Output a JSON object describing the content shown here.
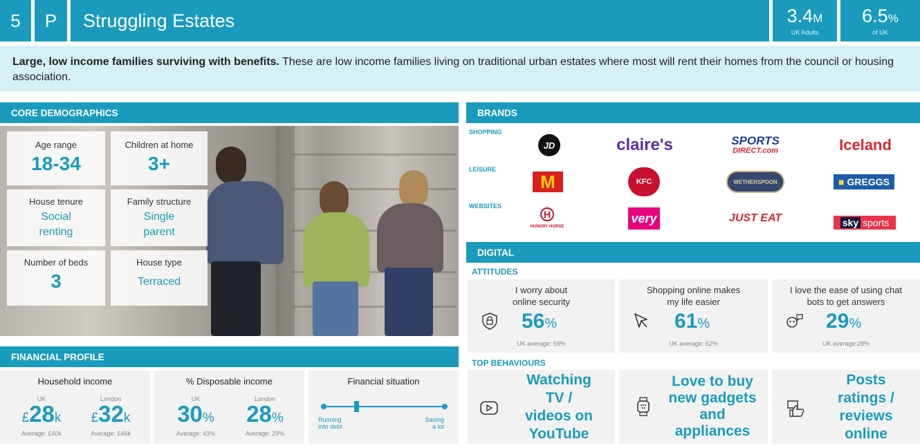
{
  "header": {
    "number": "5",
    "letter": "P",
    "title": "Struggling Estates",
    "stat1": {
      "value": "3.4",
      "unit": "M",
      "label": "UK Adults"
    },
    "stat2": {
      "value": "6.5",
      "unit": "%",
      "label": "of UK"
    }
  },
  "description": {
    "bold": "Large, low income families surviving with benefits.",
    "text": " These are low income families living on traditional urban estates where most will rent their homes from the council or housing association."
  },
  "core_demographics": {
    "heading": "CORE DEMOGRAPHICS",
    "cards": [
      {
        "label": "Age range",
        "value": "18-34"
      },
      {
        "label": "Children at home",
        "value": "3+"
      },
      {
        "label": "House tenure",
        "value_line1": "Social",
        "value_line2": "renting"
      },
      {
        "label": "Family structure",
        "value_line1": "Single",
        "value_line2": "parent"
      },
      {
        "label": "Number of beds",
        "value": "3"
      },
      {
        "label": "House type",
        "value": "Terraced"
      }
    ]
  },
  "financial_profile": {
    "heading": "FINANCIAL PROFILE",
    "household_income": {
      "title": "Household income",
      "uk_label": "UK",
      "uk_value": "28",
      "uk_prefix": "£",
      "uk_suffix": "k",
      "uk_avg": "Average: £40k",
      "london_label": "London",
      "london_value": "32",
      "london_prefix": "£",
      "london_suffix": "k",
      "london_avg": "Average: £46k"
    },
    "disposable_income": {
      "title": "% Disposable income",
      "uk_label": "UK",
      "uk_value": "30",
      "uk_suffix": "%",
      "uk_avg": "Average: 43%",
      "london_label": "London",
      "london_value": "28",
      "london_suffix": "%",
      "london_avg": "Average: 29%"
    },
    "situation": {
      "title": "Financial situation",
      "left_line1": "Running",
      "left_line2": "into debt",
      "right_line1": "Saving",
      "right_line2": "a lot",
      "position": 0.27
    }
  },
  "brands": {
    "heading": "BRANDS",
    "rows": [
      {
        "label": "SHOPPING",
        "logos": [
          "JD",
          "claire's",
          "SPORTS",
          "DIRECT.com",
          "Iceland"
        ]
      },
      {
        "label": "LEISURE",
        "logos": [
          "M",
          "KFC",
          "WETHERSPOON",
          "GREGGS"
        ]
      },
      {
        "label": "WEBSITES",
        "logos": [
          "H",
          "HUNGRY HORSE",
          "very",
          "JUST EAT",
          "sky",
          "sports"
        ]
      }
    ]
  },
  "digital": {
    "heading": "DIGITAL",
    "attitudes_heading": "ATTITUDES",
    "attitudes": [
      {
        "line1": "I worry about",
        "line2": "online security",
        "value": "56",
        "unit": "%",
        "avg": "UK average: 59%",
        "icon": "security-shield-icon"
      },
      {
        "line1": "Shopping online makes",
        "line2": "my life easier",
        "value": "61",
        "unit": "%",
        "avg": "UK average: 62%",
        "icon": "cursor-arrow-icon"
      },
      {
        "line1": "I love the ease of using chat",
        "line2": "bots to get answers",
        "value": "29",
        "unit": "%",
        "avg": "UK average:28%",
        "icon": "chatbot-icon"
      }
    ],
    "behaviours_heading": "TOP BEHAVIOURS",
    "behaviours": [
      {
        "lines": [
          "Watching",
          "TV /",
          "videos on",
          "YouTube"
        ],
        "icon": "play-button-icon"
      },
      {
        "lines": [
          "Love to buy",
          "new gadgets",
          "and",
          "appliances"
        ],
        "icon": "smartwatch-icon"
      },
      {
        "lines": [
          "Posts",
          "ratings /",
          "reviews",
          "online"
        ],
        "icon": "thumbs-up-icon"
      }
    ]
  },
  "colors": {
    "accent": "#1a9bbd",
    "light": "#d6f0f7",
    "card": "#f2f2f2"
  }
}
